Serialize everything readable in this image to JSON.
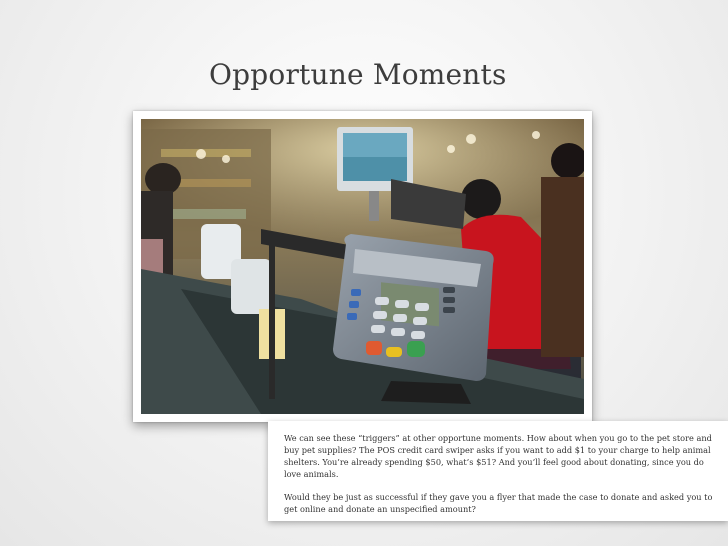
{
  "slide": {
    "title": "Opportune Moments"
  },
  "photo": {
    "subject": "pos-credit-card-terminal"
  },
  "notes": {
    "paragraph_1": "We can see these “triggers” at other opportune moments. How about when you go to the pet store and buy pet supplies? The POS credit card swiper asks if you want to add $1 to your charge to help animal shelters. You’re already spending $50, what’s $51? And you’ll feel good about donating, since you do love animals.",
    "paragraph_2": "Would they be just as successful if they gave you a flyer that made the case to donate and asked you to get online and donate an unspecified amount?"
  }
}
